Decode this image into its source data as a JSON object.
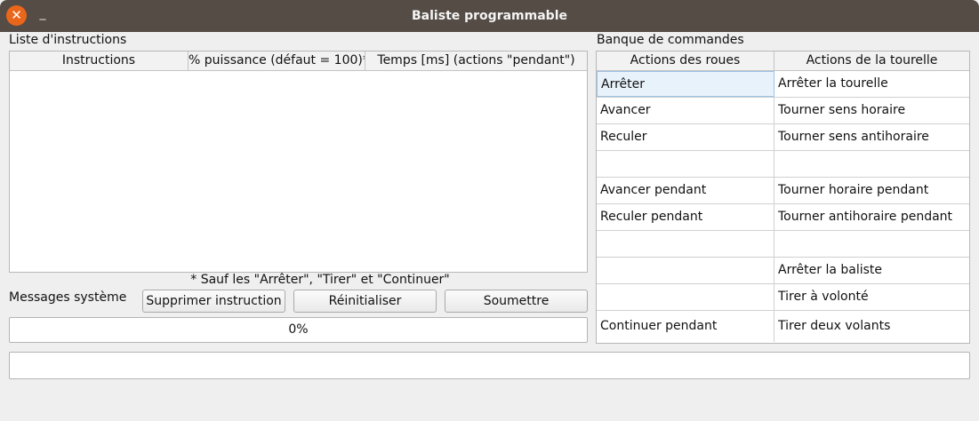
{
  "window": {
    "title": "Baliste programmable",
    "close_glyph": "✕",
    "minimize_glyph": "_"
  },
  "instructions": {
    "label": "Liste d'instructions",
    "columns": [
      "Instructions",
      "% puissance (défaut = 100)*",
      "Temps [ms] (actions \"pendant\")"
    ],
    "footnote": "* Sauf les \"Arrêter\", \"Tirer\" et \"Continuer\""
  },
  "messages": {
    "label": "Messages système"
  },
  "buttons": {
    "delete": "Supprimer instruction",
    "reset": "Réinitialiser",
    "submit": "Soumettre"
  },
  "progress": {
    "text": "0%",
    "value": 0
  },
  "commands": {
    "label": "Banque de commandes",
    "columns": [
      "Actions des roues",
      "Actions de la tourelle"
    ],
    "rows": [
      [
        "Arrêter",
        "Arrêter la tourelle"
      ],
      [
        "Avancer",
        "Tourner sens horaire"
      ],
      [
        "Reculer",
        "Tourner sens antihoraire"
      ],
      [
        "",
        ""
      ],
      [
        "Avancer pendant",
        "Tourner horaire pendant"
      ],
      [
        "Reculer pendant",
        "Tourner antihoraire pendant"
      ],
      [
        "",
        ""
      ],
      [
        "",
        "Arrêter la baliste"
      ],
      [
        "",
        "Tirer à volonté"
      ],
      [
        "Continuer pendant",
        "Tirer deux volants"
      ]
    ]
  }
}
